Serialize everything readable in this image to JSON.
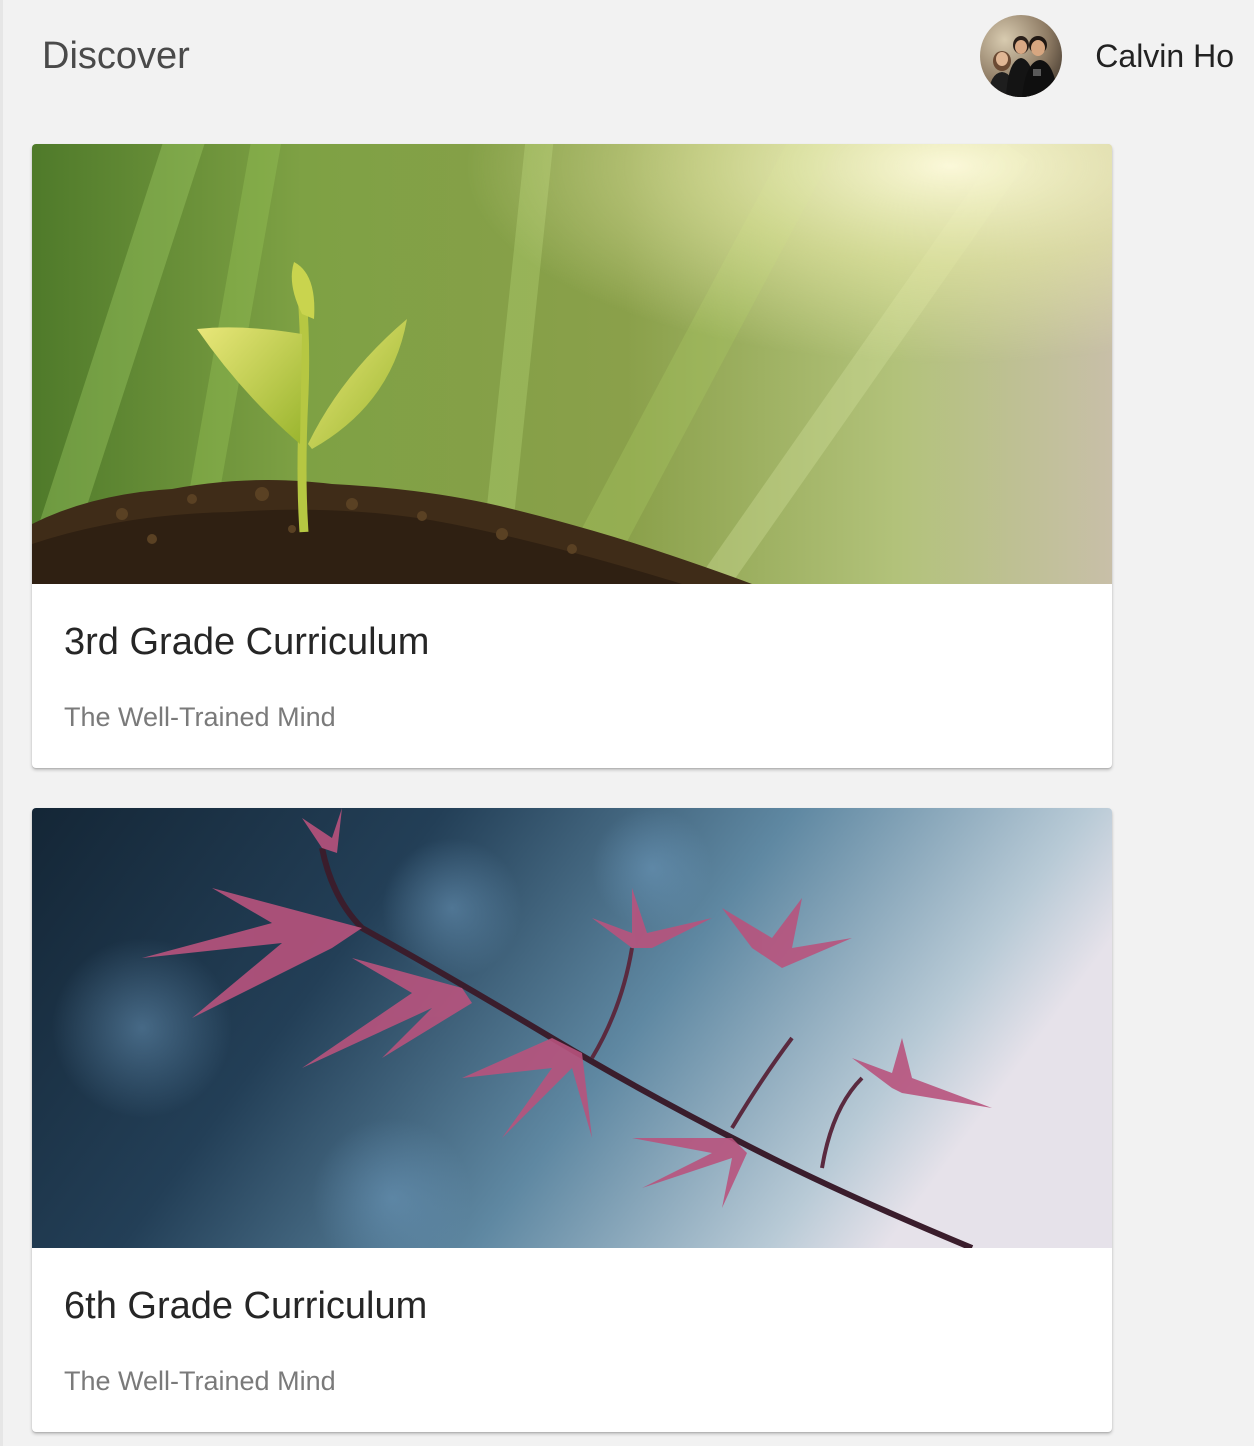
{
  "header": {
    "title": "Discover",
    "user": {
      "name": "Calvin Ho",
      "avatar_icon": "user-avatar-photo"
    }
  },
  "cards": [
    {
      "title": "3rd Grade Curriculum",
      "subtitle": "The Well-Trained Mind",
      "image_icon": "seedling-photo"
    },
    {
      "title": "6th Grade Curriculum",
      "subtitle": "The Well-Trained Mind",
      "image_icon": "red-maple-branch-photo"
    }
  ],
  "colors": {
    "background": "#f2f2f2",
    "card": "#ffffff",
    "title_text": "#262626",
    "subtitle_text": "#7a7a7a"
  }
}
